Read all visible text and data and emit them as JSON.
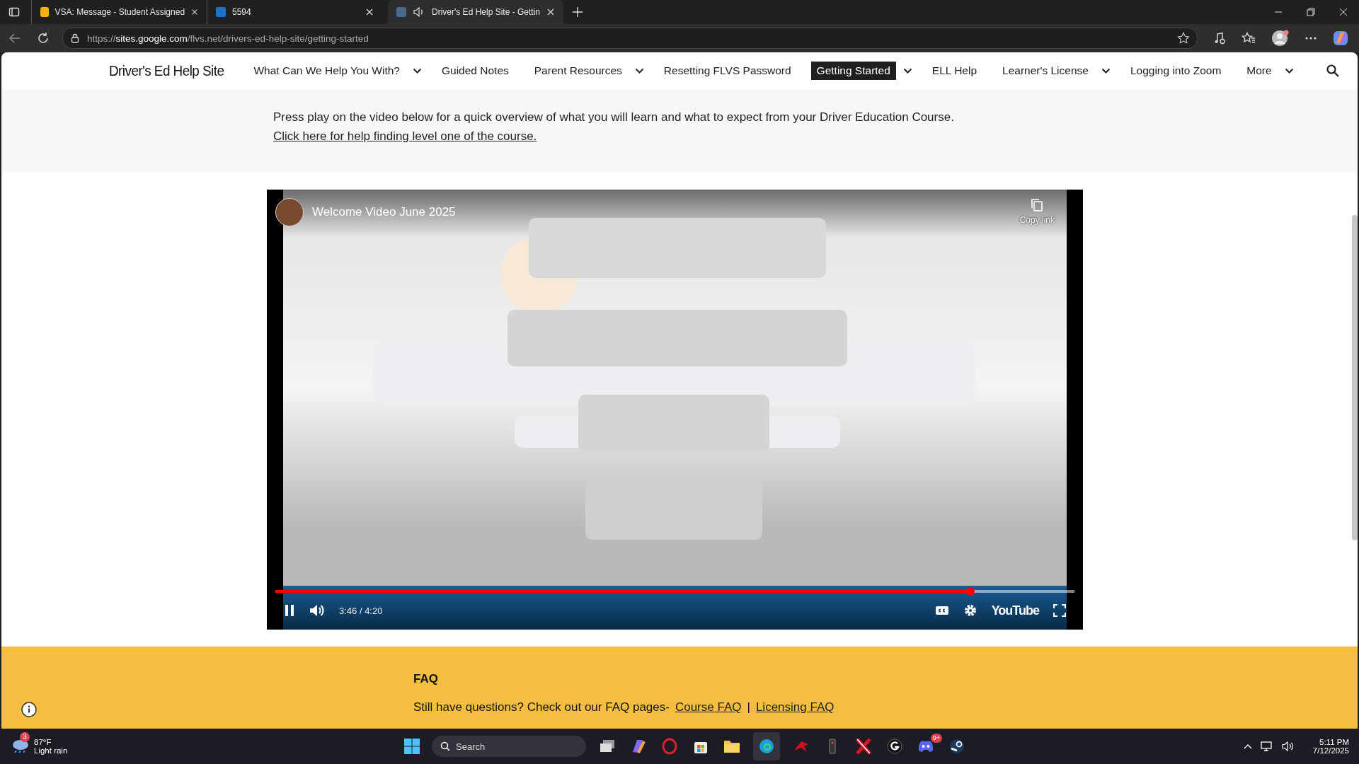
{
  "browser": {
    "tabs": [
      {
        "title": "VSA: Message - Student Assigned",
        "selected": false,
        "audio": false
      },
      {
        "title": "5594",
        "selected": false,
        "audio": false
      },
      {
        "title": "Driver's Ed Help Site - Gettin",
        "selected": true,
        "audio": true
      }
    ],
    "url_scheme": "https://",
    "url_host": "sites.google.com",
    "url_path": "/flvs.net/drivers-ed-help-site/getting-started"
  },
  "site": {
    "title": "Driver's Ed Help Site",
    "nav": [
      {
        "label": "What Can We Help You With?",
        "menu": true,
        "selected": false
      },
      {
        "label": "Guided Notes",
        "menu": false,
        "selected": false
      },
      {
        "label": "Parent Resources",
        "menu": true,
        "selected": false
      },
      {
        "label": "Resetting FLVS Password",
        "menu": false,
        "selected": false
      },
      {
        "label": "Getting Started",
        "menu": true,
        "selected": true
      },
      {
        "label": "ELL Help",
        "menu": false,
        "selected": false
      },
      {
        "label": "Learner's License",
        "menu": true,
        "selected": false
      },
      {
        "label": "Logging into Zoom",
        "menu": false,
        "selected": false
      },
      {
        "label": "More",
        "menu": true,
        "selected": false
      }
    ]
  },
  "intro": {
    "text": "Press play on the video below for a quick overview of what you will learn and what to expect from your Driver Education Course.",
    "link": "Click here for help finding level one of the course."
  },
  "video": {
    "title": "Welcome Video June 2025",
    "copy_label": "Copy link",
    "time": "3:46 / 4:20",
    "level": 0.87,
    "playing": true,
    "logo": "YouTube"
  },
  "faq": {
    "heading": "FAQ",
    "text": "Still have questions? Check out our FAQ pages-",
    "links": [
      "Course FAQ",
      "Licensing FAQ"
    ],
    "separator": "|"
  },
  "taskbar": {
    "weather_badge": "3",
    "temperature": "87°F",
    "condition": "Light rain",
    "search_placeholder": "Search",
    "app_badge": "9+",
    "time": "5:11 PM",
    "date": "7/12/2025"
  }
}
